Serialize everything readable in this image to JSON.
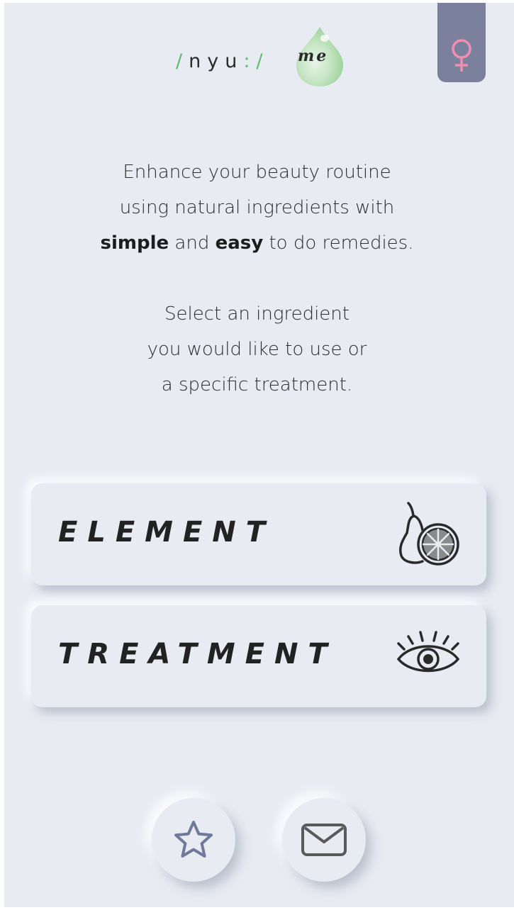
{
  "logo": {
    "slash_left": "/",
    "brand": "nyu",
    "colon": ":",
    "slash_right": "/",
    "suffix": "me"
  },
  "gender_tab": {
    "icon": "female-symbol-icon",
    "background": "#7b819c",
    "icon_color": "#f28fb0"
  },
  "intro": {
    "line1": "Enhance your beauty routine",
    "line2": "using natural ingredients with",
    "line3_bold1": "simple",
    "line3_mid": "and",
    "line3_bold2": "easy",
    "line3_end": "to do remedies.",
    "line4": "Select an ingredient",
    "line5": "you would like to use or",
    "line6": "a specific treatment."
  },
  "options": {
    "element": {
      "label": "ELEMENT",
      "icon": "pear-orange-icon"
    },
    "treatment": {
      "label": "TREATMENT",
      "icon": "eye-icon"
    }
  },
  "bottom_nav": {
    "favorites_icon": "star-icon",
    "contact_icon": "mail-icon"
  },
  "colors": {
    "background": "#e9ebf3",
    "accent_green": "#5fbd68",
    "icon_blue": "#6f7a9b",
    "icon_gray": "#5a5a5a"
  }
}
